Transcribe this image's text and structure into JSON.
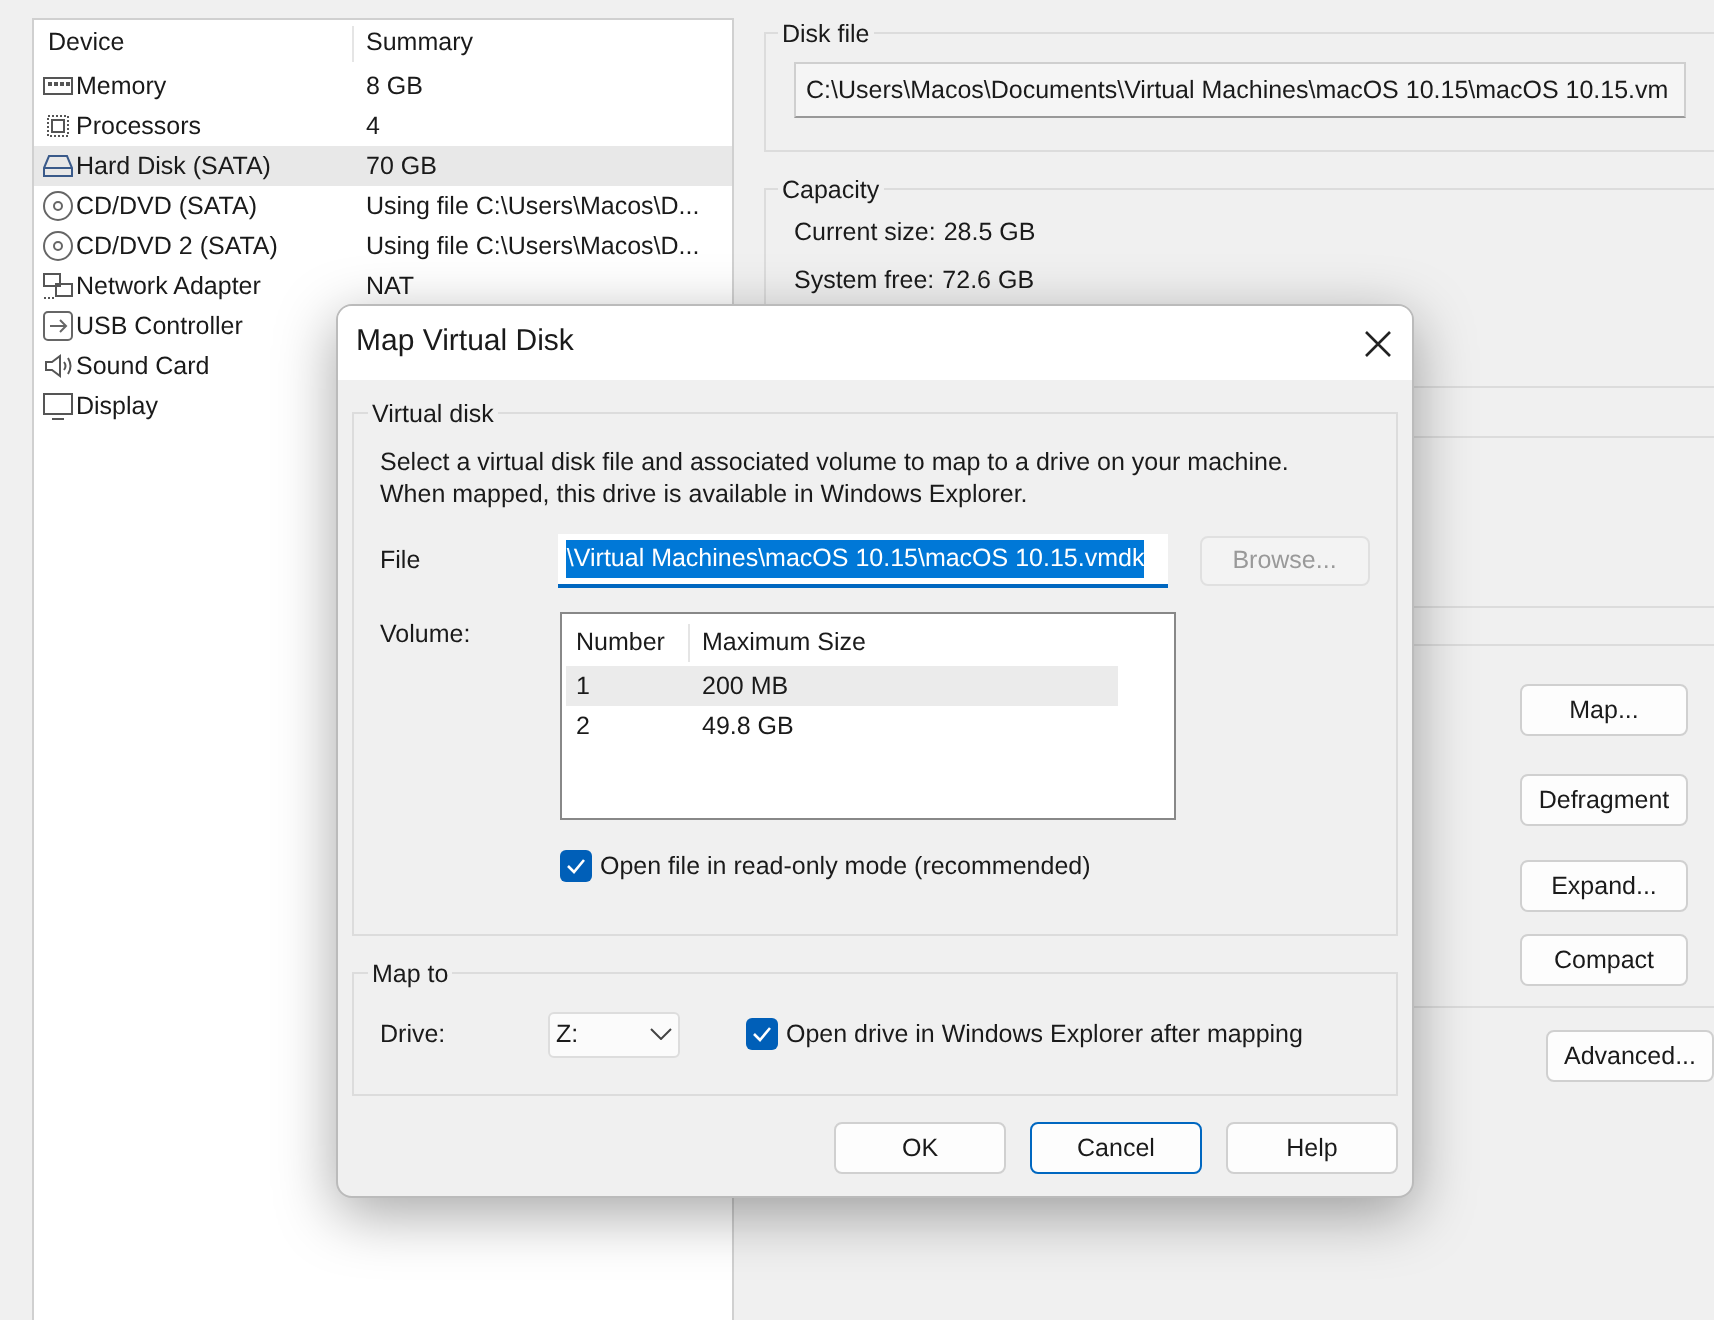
{
  "device_table": {
    "columns": [
      "Device",
      "Summary"
    ],
    "rows": [
      {
        "kind": "memory",
        "device": "Memory",
        "summary": "8 GB",
        "selected": false
      },
      {
        "kind": "processor",
        "device": "Processors",
        "summary": "4",
        "selected": false
      },
      {
        "kind": "disk",
        "device": "Hard Disk (SATA)",
        "summary": "70 GB",
        "selected": true
      },
      {
        "kind": "cd",
        "device": "CD/DVD (SATA)",
        "summary": "Using file C:\\Users\\Macos\\D...",
        "selected": false
      },
      {
        "kind": "cd",
        "device": "CD/DVD 2 (SATA)",
        "summary": "Using file C:\\Users\\Macos\\D...",
        "selected": false
      },
      {
        "kind": "network",
        "device": "Network Adapter",
        "summary": "NAT",
        "selected": false
      },
      {
        "kind": "usb",
        "device": "USB Controller",
        "selected": false
      },
      {
        "kind": "sound",
        "device": "Sound Card",
        "selected": false
      },
      {
        "kind": "display",
        "device": "Display",
        "selected": false
      }
    ]
  },
  "disk_file": {
    "title": "Disk file",
    "value": "C:\\Users\\Macos\\Documents\\Virtual Machines\\macOS 10.15\\macOS 10.15.vm"
  },
  "capacity": {
    "title": "Capacity",
    "items": [
      {
        "label": "Current size:",
        "value": "28.5 GB"
      },
      {
        "label": "System free:",
        "value": "72.6 GB"
      }
    ]
  },
  "utility_buttons": [
    "Map...",
    "Defragment",
    "Expand...",
    "Compact"
  ],
  "advanced_button": "Advanced...",
  "dialog": {
    "title": "Map Virtual Disk",
    "virtual_disk": {
      "title": "Virtual disk",
      "description": "Select a virtual disk file and associated volume to map to a drive on your machine. When mapped, this drive is available in Windows Explorer.",
      "file_label": "File",
      "file_value": "\\Virtual Machines\\macOS 10.15\\macOS 10.15.vmdk",
      "file_text_selected": true,
      "browse": {
        "label": "Browse...",
        "disabled": true
      },
      "volume_label": "Volume:",
      "volume_columns": [
        "Number",
        "Maximum Size"
      ],
      "volumes": [
        {
          "number": "1",
          "size": "200 MB",
          "selected": true
        },
        {
          "number": "2",
          "size": "49.8 GB",
          "selected": false
        }
      ],
      "read_only": {
        "label": "Open file in read-only mode (recommended)",
        "checked": true
      }
    },
    "map_to": {
      "title": "Map to",
      "drive_label": "Drive:",
      "drive": "Z:",
      "open_explorer": {
        "label": "Open drive in Windows Explorer after mapping",
        "checked": true
      }
    },
    "buttons": [
      {
        "label": "OK",
        "default": false
      },
      {
        "label": "Cancel",
        "default": true
      },
      {
        "label": "Help",
        "default": false
      }
    ]
  }
}
